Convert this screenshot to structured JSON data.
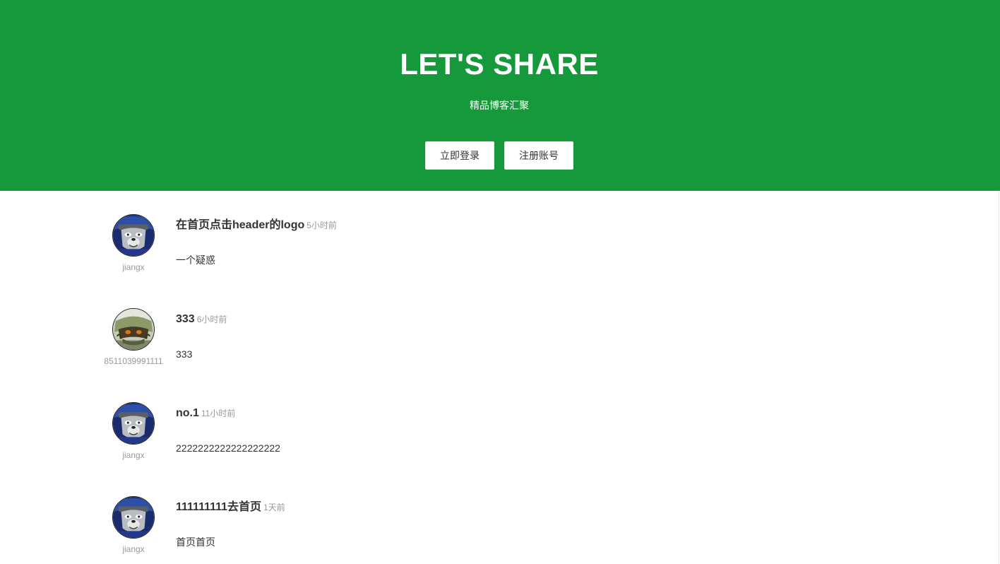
{
  "hero": {
    "title": "LET'S SHARE",
    "subtitle": "精品博客汇聚",
    "login_label": "立即登录",
    "register_label": "注册账号",
    "background_color": "#16993a"
  },
  "posts": [
    {
      "author": "jiangx",
      "title": "在首页点击header的logo",
      "time": "5小时前",
      "body": "一个疑惑",
      "avatar": "wolf-avatar"
    },
    {
      "author": "8511039991111",
      "title": "333",
      "time": "6小时前",
      "body": "333",
      "avatar": "creature-avatar"
    },
    {
      "author": "jiangx",
      "title": "no.1",
      "time": "11小时前",
      "body": "2222222222222222222",
      "avatar": "wolf-avatar"
    },
    {
      "author": "jiangx",
      "title": "111111111去首页",
      "time": "1天前",
      "body": "首页首页",
      "avatar": "wolf-avatar"
    }
  ]
}
